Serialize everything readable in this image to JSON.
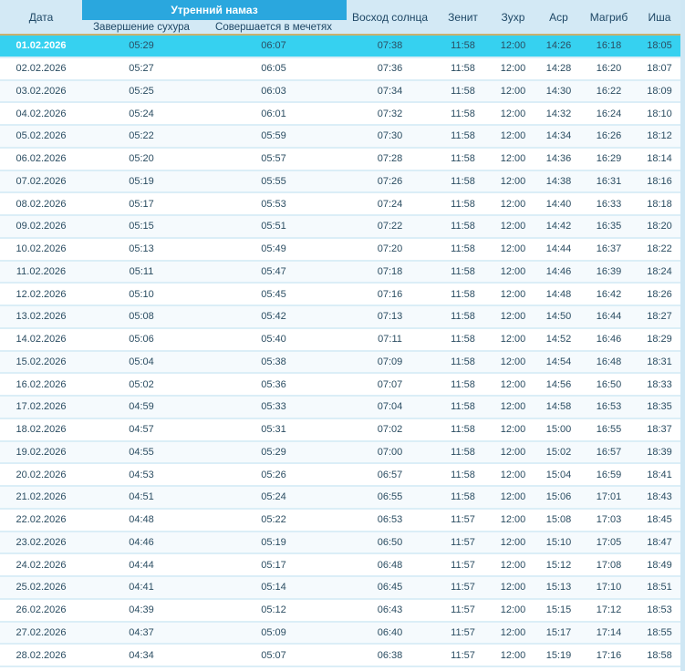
{
  "colors": {
    "banner_bg": "#2aa7de",
    "header_bg": "#d3e9f5",
    "highlight_bg": "#36d1f0",
    "highlight_border": "#c8b06e",
    "row_separator": "#dbeef7",
    "row_alt_bg": "#f5fafd",
    "text": "#2b4d62",
    "header_text": "#1e4765",
    "right_strip": "#cfe7f4"
  },
  "table": {
    "columns": {
      "date": "Дата",
      "morning_group": "Утренний намаз",
      "suhoor_end": "Завершение сухура",
      "mosque": "Совершается в мечетях",
      "sunrise": "Восход солнца",
      "zenith": "Зенит",
      "zuhr": "Зухр",
      "asr": "Аср",
      "maghrib": "Магриб",
      "isha": "Иша"
    },
    "selected_row_index": 0,
    "rows": [
      {
        "date": "01.02.2026",
        "suhoor_end": "05:29",
        "mosque": "06:07",
        "sunrise": "07:38",
        "zenith": "11:58",
        "zuhr": "12:00",
        "asr": "14:26",
        "maghrib": "16:18",
        "isha": "18:05"
      },
      {
        "date": "02.02.2026",
        "suhoor_end": "05:27",
        "mosque": "06:05",
        "sunrise": "07:36",
        "zenith": "11:58",
        "zuhr": "12:00",
        "asr": "14:28",
        "maghrib": "16:20",
        "isha": "18:07"
      },
      {
        "date": "03.02.2026",
        "suhoor_end": "05:25",
        "mosque": "06:03",
        "sunrise": "07:34",
        "zenith": "11:58",
        "zuhr": "12:00",
        "asr": "14:30",
        "maghrib": "16:22",
        "isha": "18:09"
      },
      {
        "date": "04.02.2026",
        "suhoor_end": "05:24",
        "mosque": "06:01",
        "sunrise": "07:32",
        "zenith": "11:58",
        "zuhr": "12:00",
        "asr": "14:32",
        "maghrib": "16:24",
        "isha": "18:10"
      },
      {
        "date": "05.02.2026",
        "suhoor_end": "05:22",
        "mosque": "05:59",
        "sunrise": "07:30",
        "zenith": "11:58",
        "zuhr": "12:00",
        "asr": "14:34",
        "maghrib": "16:26",
        "isha": "18:12"
      },
      {
        "date": "06.02.2026",
        "suhoor_end": "05:20",
        "mosque": "05:57",
        "sunrise": "07:28",
        "zenith": "11:58",
        "zuhr": "12:00",
        "asr": "14:36",
        "maghrib": "16:29",
        "isha": "18:14"
      },
      {
        "date": "07.02.2026",
        "suhoor_end": "05:19",
        "mosque": "05:55",
        "sunrise": "07:26",
        "zenith": "11:58",
        "zuhr": "12:00",
        "asr": "14:38",
        "maghrib": "16:31",
        "isha": "18:16"
      },
      {
        "date": "08.02.2026",
        "suhoor_end": "05:17",
        "mosque": "05:53",
        "sunrise": "07:24",
        "zenith": "11:58",
        "zuhr": "12:00",
        "asr": "14:40",
        "maghrib": "16:33",
        "isha": "18:18"
      },
      {
        "date": "09.02.2026",
        "suhoor_end": "05:15",
        "mosque": "05:51",
        "sunrise": "07:22",
        "zenith": "11:58",
        "zuhr": "12:00",
        "asr": "14:42",
        "maghrib": "16:35",
        "isha": "18:20"
      },
      {
        "date": "10.02.2026",
        "suhoor_end": "05:13",
        "mosque": "05:49",
        "sunrise": "07:20",
        "zenith": "11:58",
        "zuhr": "12:00",
        "asr": "14:44",
        "maghrib": "16:37",
        "isha": "18:22"
      },
      {
        "date": "11.02.2026",
        "suhoor_end": "05:11",
        "mosque": "05:47",
        "sunrise": "07:18",
        "zenith": "11:58",
        "zuhr": "12:00",
        "asr": "14:46",
        "maghrib": "16:39",
        "isha": "18:24"
      },
      {
        "date": "12.02.2026",
        "suhoor_end": "05:10",
        "mosque": "05:45",
        "sunrise": "07:16",
        "zenith": "11:58",
        "zuhr": "12:00",
        "asr": "14:48",
        "maghrib": "16:42",
        "isha": "18:26"
      },
      {
        "date": "13.02.2026",
        "suhoor_end": "05:08",
        "mosque": "05:42",
        "sunrise": "07:13",
        "zenith": "11:58",
        "zuhr": "12:00",
        "asr": "14:50",
        "maghrib": "16:44",
        "isha": "18:27"
      },
      {
        "date": "14.02.2026",
        "suhoor_end": "05:06",
        "mosque": "05:40",
        "sunrise": "07:11",
        "zenith": "11:58",
        "zuhr": "12:00",
        "asr": "14:52",
        "maghrib": "16:46",
        "isha": "18:29"
      },
      {
        "date": "15.02.2026",
        "suhoor_end": "05:04",
        "mosque": "05:38",
        "sunrise": "07:09",
        "zenith": "11:58",
        "zuhr": "12:00",
        "asr": "14:54",
        "maghrib": "16:48",
        "isha": "18:31"
      },
      {
        "date": "16.02.2026",
        "suhoor_end": "05:02",
        "mosque": "05:36",
        "sunrise": "07:07",
        "zenith": "11:58",
        "zuhr": "12:00",
        "asr": "14:56",
        "maghrib": "16:50",
        "isha": "18:33"
      },
      {
        "date": "17.02.2026",
        "suhoor_end": "04:59",
        "mosque": "05:33",
        "sunrise": "07:04",
        "zenith": "11:58",
        "zuhr": "12:00",
        "asr": "14:58",
        "maghrib": "16:53",
        "isha": "18:35"
      },
      {
        "date": "18.02.2026",
        "suhoor_end": "04:57",
        "mosque": "05:31",
        "sunrise": "07:02",
        "zenith": "11:58",
        "zuhr": "12:00",
        "asr": "15:00",
        "maghrib": "16:55",
        "isha": "18:37"
      },
      {
        "date": "19.02.2026",
        "suhoor_end": "04:55",
        "mosque": "05:29",
        "sunrise": "07:00",
        "zenith": "11:58",
        "zuhr": "12:00",
        "asr": "15:02",
        "maghrib": "16:57",
        "isha": "18:39"
      },
      {
        "date": "20.02.2026",
        "suhoor_end": "04:53",
        "mosque": "05:26",
        "sunrise": "06:57",
        "zenith": "11:58",
        "zuhr": "12:00",
        "asr": "15:04",
        "maghrib": "16:59",
        "isha": "18:41"
      },
      {
        "date": "21.02.2026",
        "suhoor_end": "04:51",
        "mosque": "05:24",
        "sunrise": "06:55",
        "zenith": "11:58",
        "zuhr": "12:00",
        "asr": "15:06",
        "maghrib": "17:01",
        "isha": "18:43"
      },
      {
        "date": "22.02.2026",
        "suhoor_end": "04:48",
        "mosque": "05:22",
        "sunrise": "06:53",
        "zenith": "11:57",
        "zuhr": "12:00",
        "asr": "15:08",
        "maghrib": "17:03",
        "isha": "18:45"
      },
      {
        "date": "23.02.2026",
        "suhoor_end": "04:46",
        "mosque": "05:19",
        "sunrise": "06:50",
        "zenith": "11:57",
        "zuhr": "12:00",
        "asr": "15:10",
        "maghrib": "17:05",
        "isha": "18:47"
      },
      {
        "date": "24.02.2026",
        "suhoor_end": "04:44",
        "mosque": "05:17",
        "sunrise": "06:48",
        "zenith": "11:57",
        "zuhr": "12:00",
        "asr": "15:12",
        "maghrib": "17:08",
        "isha": "18:49"
      },
      {
        "date": "25.02.2026",
        "suhoor_end": "04:41",
        "mosque": "05:14",
        "sunrise": "06:45",
        "zenith": "11:57",
        "zuhr": "12:00",
        "asr": "15:13",
        "maghrib": "17:10",
        "isha": "18:51"
      },
      {
        "date": "26.02.2026",
        "suhoor_end": "04:39",
        "mosque": "05:12",
        "sunrise": "06:43",
        "zenith": "11:57",
        "zuhr": "12:00",
        "asr": "15:15",
        "maghrib": "17:12",
        "isha": "18:53"
      },
      {
        "date": "27.02.2026",
        "suhoor_end": "04:37",
        "mosque": "05:09",
        "sunrise": "06:40",
        "zenith": "11:57",
        "zuhr": "12:00",
        "asr": "15:17",
        "maghrib": "17:14",
        "isha": "18:55"
      },
      {
        "date": "28.02.2026",
        "suhoor_end": "04:34",
        "mosque": "05:07",
        "sunrise": "06:38",
        "zenith": "11:57",
        "zuhr": "12:00",
        "asr": "15:19",
        "maghrib": "17:16",
        "isha": "18:58"
      }
    ]
  }
}
